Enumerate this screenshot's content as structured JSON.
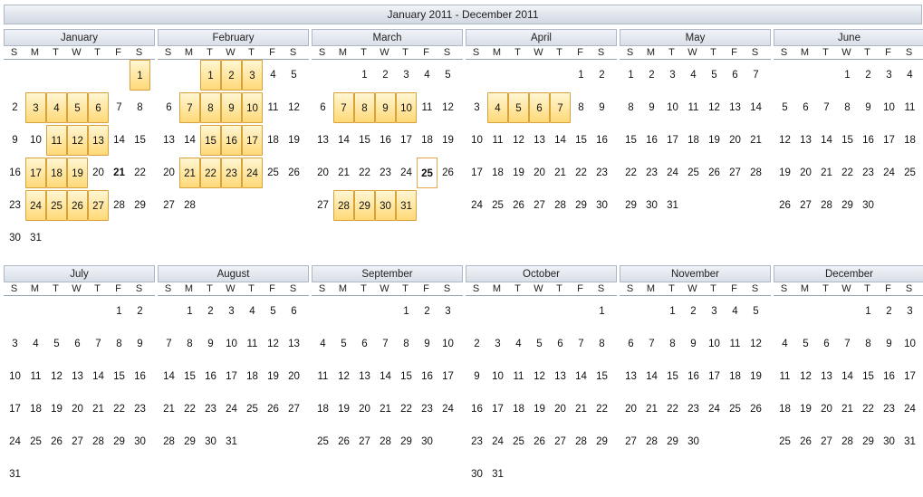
{
  "title": "January 2011 - December 2011",
  "day_headers": [
    "S",
    "M",
    "T",
    "W",
    "T",
    "F",
    "S"
  ],
  "months": [
    {
      "name": "January",
      "start": 6,
      "days": 31,
      "selected": [
        1,
        3,
        4,
        5,
        6,
        11,
        12,
        13,
        17,
        18,
        19,
        24,
        25,
        26,
        27
      ],
      "bold": [
        21
      ]
    },
    {
      "name": "February",
      "start": 2,
      "days": 28,
      "selected": [
        1,
        2,
        3,
        7,
        8,
        9,
        10,
        15,
        16,
        17,
        21,
        22,
        23,
        24
      ]
    },
    {
      "name": "March",
      "start": 2,
      "days": 31,
      "selected": [
        7,
        8,
        9,
        10,
        28,
        29,
        30,
        31
      ],
      "today": 25
    },
    {
      "name": "April",
      "start": 5,
      "days": 30,
      "selected": [
        4,
        5,
        6,
        7
      ]
    },
    {
      "name": "May",
      "start": 0,
      "days": 31,
      "selected": []
    },
    {
      "name": "June",
      "start": 3,
      "days": 30,
      "selected": []
    },
    {
      "name": "July",
      "start": 5,
      "days": 31,
      "selected": []
    },
    {
      "name": "August",
      "start": 1,
      "days": 31,
      "selected": []
    },
    {
      "name": "September",
      "start": 4,
      "days": 30,
      "selected": []
    },
    {
      "name": "October",
      "start": 6,
      "days": 31,
      "selected": []
    },
    {
      "name": "November",
      "start": 2,
      "days": 30,
      "selected": []
    },
    {
      "name": "December",
      "start": 4,
      "days": 31,
      "selected": []
    }
  ]
}
